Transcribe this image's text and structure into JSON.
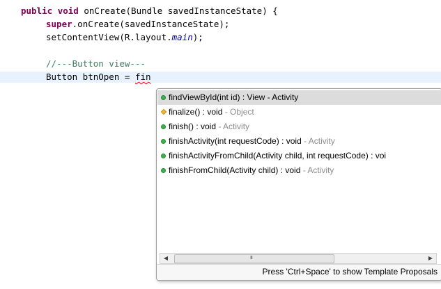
{
  "code": {
    "line1": {
      "kw_public": "public",
      "kw_void": "void",
      "signature": "onCreate(Bundle savedInstanceState) {"
    },
    "line2": {
      "kw_super": "super",
      "rest": ".onCreate(savedInstanceState);"
    },
    "line3": {
      "prefix": "setContentView(R.layout.",
      "field": "main",
      "suffix": ");"
    },
    "line4": {
      "comment": "//---Button view---"
    },
    "line5": {
      "text": "Button btnOpen = ",
      "typed": "fin"
    }
  },
  "autocomplete": {
    "items": [
      {
        "text": "findViewById(int id) : View - Activity",
        "owner": "",
        "icon": "public-method-icon",
        "selected": true
      },
      {
        "text": "finalize() : void",
        "owner": " - Object",
        "icon": "protected-method-icon",
        "selected": false
      },
      {
        "text": "finish() : void",
        "owner": " - Activity",
        "icon": "public-method-icon",
        "selected": false
      },
      {
        "text": "finishActivity(int requestCode) : void",
        "owner": " - Activity",
        "icon": "public-method-icon",
        "selected": false
      },
      {
        "text": "finishActivityFromChild(Activity child, int requestCode) : voi",
        "owner": "",
        "icon": "public-method-icon",
        "selected": false
      },
      {
        "text": "finishFromChild(Activity child) : void",
        "owner": " - Activity",
        "icon": "public-method-icon",
        "selected": false
      }
    ],
    "scroll_left": "◀",
    "scroll_right": "▶",
    "scroll_grip": "III",
    "status": "Press 'Ctrl+Space' to show Template Proposals",
    "colors": {
      "public_icon": "#3bb34a",
      "protected_icon": "#f5b73b",
      "owner_text": "#8c8c8c",
      "keyword": "#7f0055",
      "comment": "#3f7f5f"
    }
  }
}
